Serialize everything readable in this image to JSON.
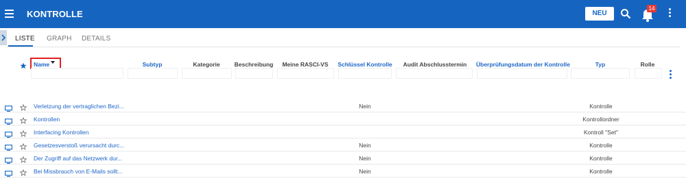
{
  "app": {
    "title": "KONTROLLE",
    "new_label": "NEU",
    "notification_count": "14",
    "accent": "#1565c0"
  },
  "tabs": [
    {
      "label": "LISTE",
      "active": true
    },
    {
      "label": "GRAPH",
      "active": false
    },
    {
      "label": "DETAILS",
      "active": false
    }
  ],
  "columns": {
    "name": "Name",
    "subtyp": "Subtyp",
    "kategorie": "Kategorie",
    "beschreibung": "Beschreibung",
    "rasci": "Meine RASCI-VS",
    "schluessel": "Schlüssel Kontrolle",
    "audit": "Audit Abschlusstermin",
    "pruefung": "Überprüfungsdatum der Kontrolle",
    "typ": "Typ",
    "rolle": "Rolle"
  },
  "rows": [
    {
      "name": "Verletzung der vertraglichen Bezi...",
      "key": "Nein",
      "typ": "Kontrolle"
    },
    {
      "name": "Kontrollen",
      "key": "",
      "typ": "Kontrollordner"
    },
    {
      "name": "Interfacing Kontrollen",
      "key": "",
      "typ": "Kontroll \"Set\""
    },
    {
      "name": "Gesetzesverstoß verursacht durc...",
      "key": "Nein",
      "typ": "Kontrolle"
    },
    {
      "name": "Der Zugriff auf das Netzwerk dur...",
      "key": "Nein",
      "typ": "Kontrolle"
    },
    {
      "name": "Bei Missbrauch von E-Mails sollt...",
      "key": "Nein",
      "typ": "Kontrolle"
    }
  ]
}
